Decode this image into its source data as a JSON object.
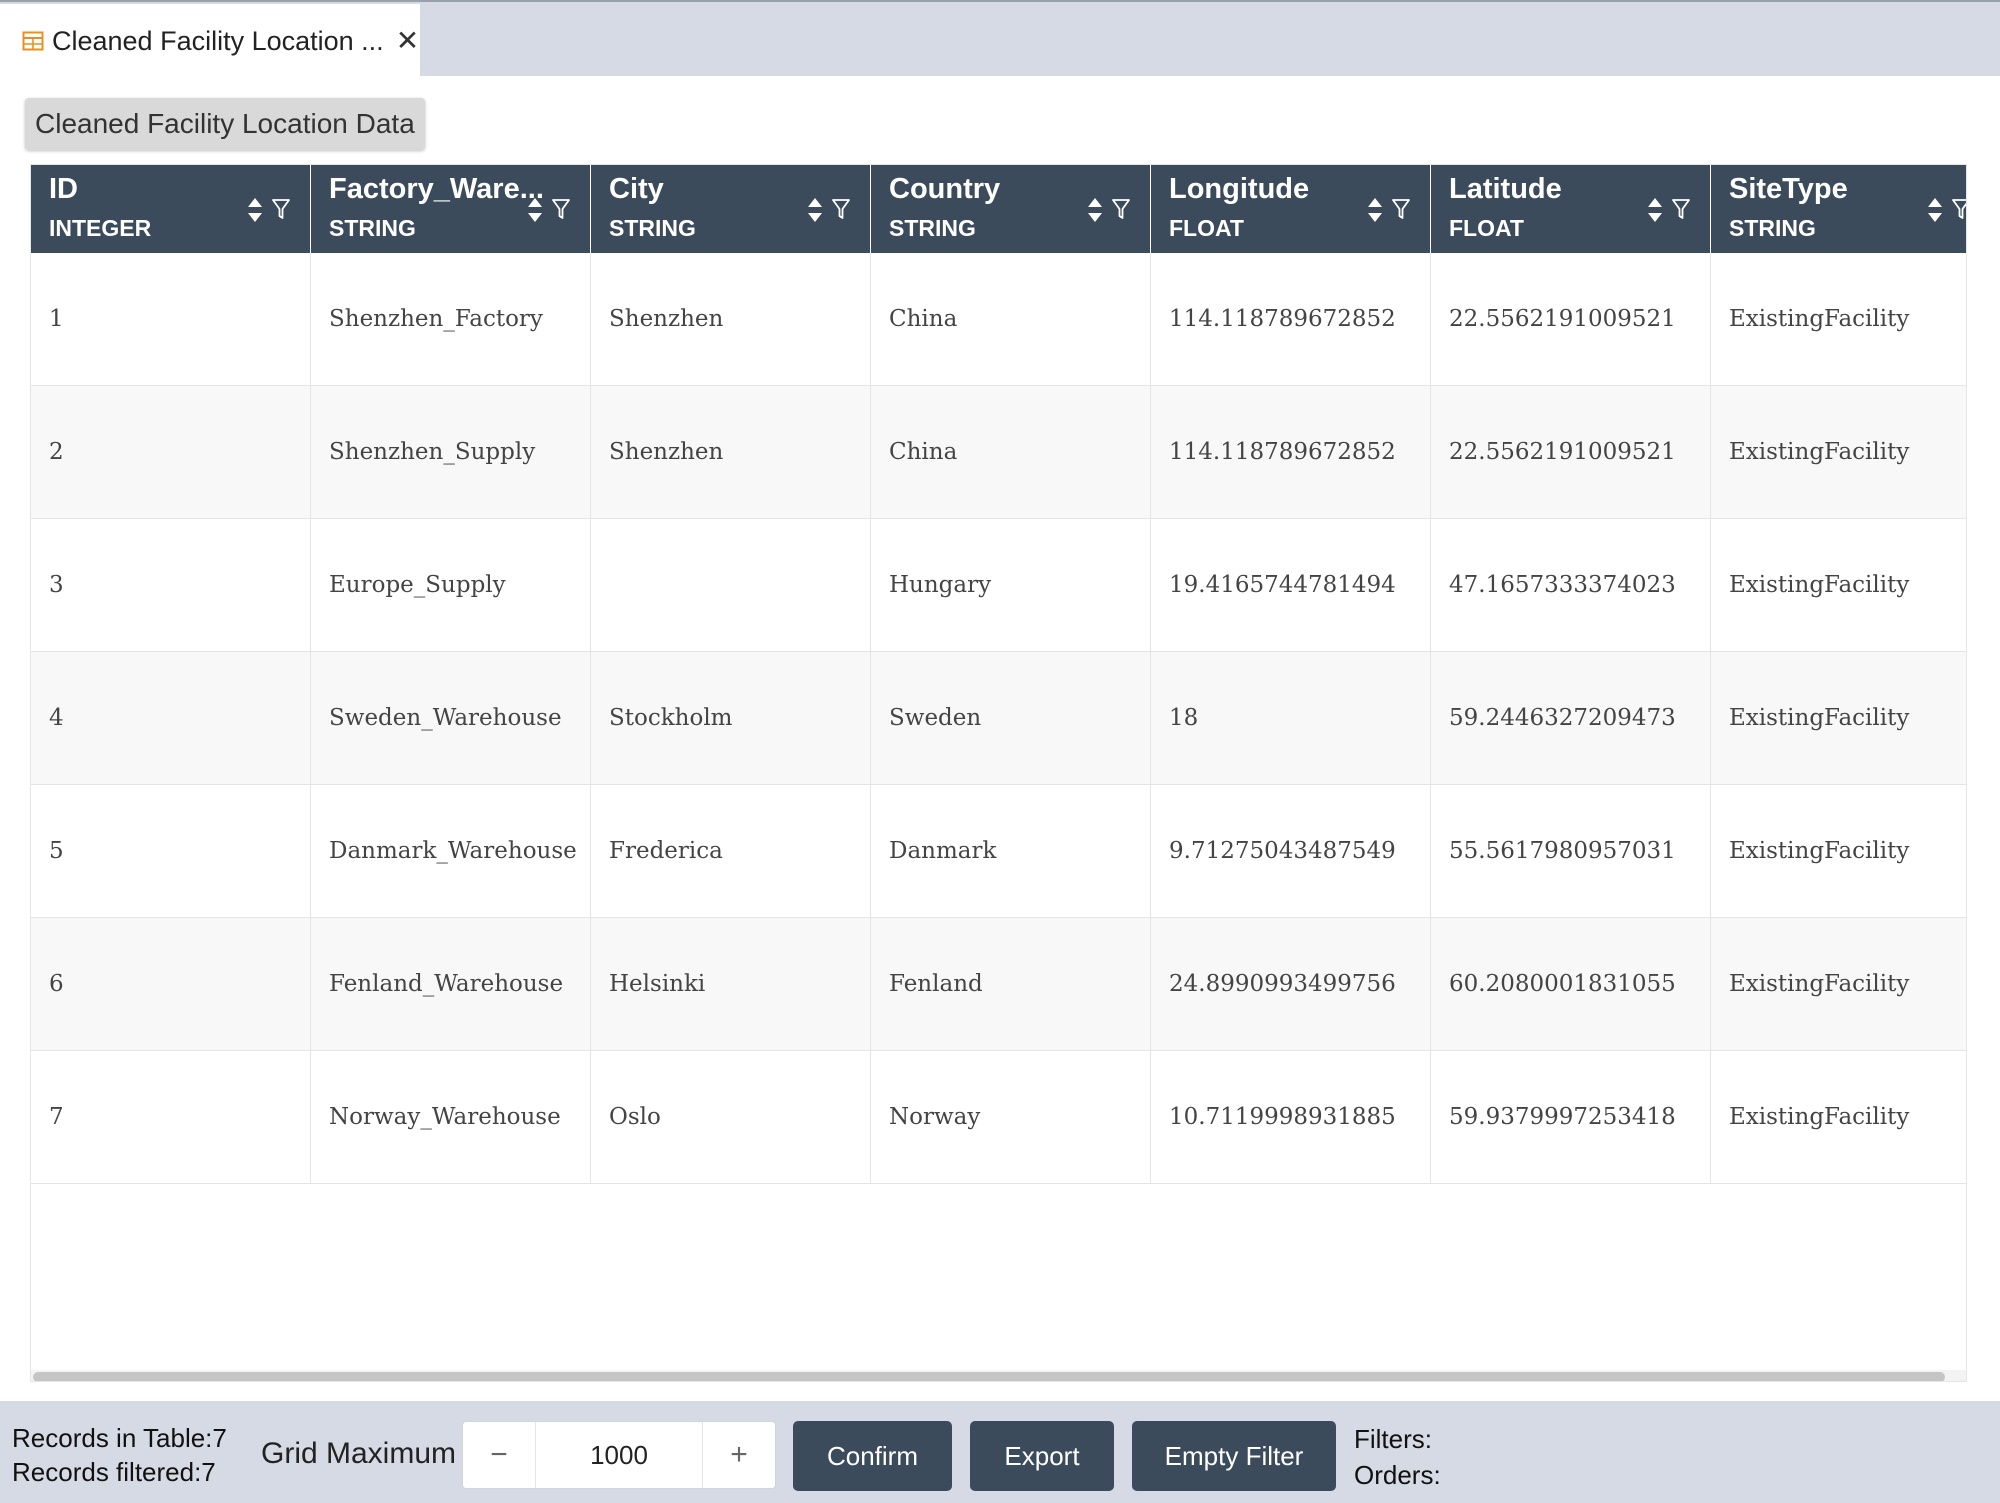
{
  "tab": {
    "icon": "table-icon",
    "label": "Cleaned Facility Location ...",
    "close_icon": "close-icon"
  },
  "table_title": "Cleaned Facility Location Data",
  "columns": [
    {
      "name": "ID",
      "type": "INTEGER"
    },
    {
      "name": "Factory_Ware...",
      "type": "STRING"
    },
    {
      "name": "City",
      "type": "STRING"
    },
    {
      "name": "Country",
      "type": "STRING"
    },
    {
      "name": "Longitude",
      "type": "FLOAT"
    },
    {
      "name": "Latitude",
      "type": "FLOAT"
    },
    {
      "name": "SiteType",
      "type": "STRING"
    }
  ],
  "rows": [
    [
      "1",
      "Shenzhen_Factory",
      "Shenzhen",
      "China",
      "114.118789672852",
      "22.5562191009521",
      "ExistingFacility"
    ],
    [
      "2",
      "Shenzhen_Supply",
      "Shenzhen",
      "China",
      "114.118789672852",
      "22.5562191009521",
      "ExistingFacility"
    ],
    [
      "3",
      "Europe_Supply",
      "",
      "Hungary",
      "19.4165744781494",
      "47.1657333374023",
      "ExistingFacility"
    ],
    [
      "4",
      "Sweden_Warehouse",
      "Stockholm",
      "Sweden",
      "18",
      "59.2446327209473",
      "ExistingFacility"
    ],
    [
      "5",
      "Danmark_Warehouse",
      "Frederica",
      "Danmark",
      "9.71275043487549",
      "55.5617980957031",
      "ExistingFacility"
    ],
    [
      "6",
      "Fenland_Warehouse",
      "Helsinki",
      "Fenland",
      "24.8990993499756",
      "60.2080001831055",
      "ExistingFacility"
    ],
    [
      "7",
      "Norway_Warehouse",
      "Oslo",
      "Norway",
      "10.7119998931885",
      "59.9379997253418",
      "ExistingFacility"
    ]
  ],
  "footer": {
    "records_in_table": "Records in Table:7",
    "records_filtered": "Records filtered:7",
    "grid_maximum_label": "Grid Maximum",
    "grid_maximum_value": "1000",
    "decrement_label": "−",
    "increment_label": "+",
    "confirm_label": "Confirm",
    "export_label": "Export",
    "empty_filter_label": "Empty Filter",
    "filters_label": "Filters:",
    "orders_label": "Orders:"
  },
  "colors": {
    "header_bg": "#3b4b5c",
    "tabbar_bg": "#d6dae5",
    "tab_icon": "#e8901f"
  }
}
